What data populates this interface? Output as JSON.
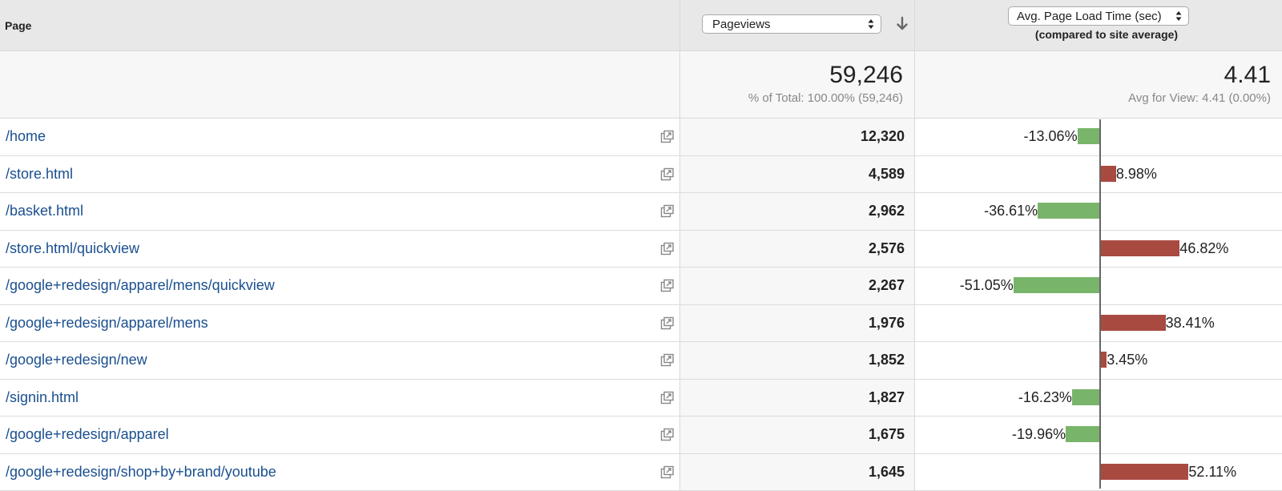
{
  "header": {
    "page_label": "Page",
    "pageviews_select": "Pageviews",
    "loadtime_select": "Avg. Page Load Time (sec)",
    "loadtime_subtitle": "(compared to site average)"
  },
  "totals": {
    "pageviews_value": "59,246",
    "pageviews_sub": "% of Total: 100.00% (59,246)",
    "loadtime_value": "4.41",
    "loadtime_sub": "Avg for View: 4.41 (0.00%)"
  },
  "rows": [
    {
      "page": "/home",
      "pageviews": "12,320",
      "delta_label": "-13.06%",
      "delta": -13.06
    },
    {
      "page": "/store.html",
      "pageviews": "4,589",
      "delta_label": "8.98%",
      "delta": 8.98
    },
    {
      "page": "/basket.html",
      "pageviews": "2,962",
      "delta_label": "-36.61%",
      "delta": -36.61
    },
    {
      "page": "/store.html/quickview",
      "pageviews": "2,576",
      "delta_label": "46.82%",
      "delta": 46.82
    },
    {
      "page": "/google+redesign/apparel/mens/quickview",
      "pageviews": "2,267",
      "delta_label": "-51.05%",
      "delta": -51.05
    },
    {
      "page": "/google+redesign/apparel/mens",
      "pageviews": "1,976",
      "delta_label": "38.41%",
      "delta": 38.41
    },
    {
      "page": "/google+redesign/new",
      "pageviews": "1,852",
      "delta_label": "3.45%",
      "delta": 3.45
    },
    {
      "page": "/signin.html",
      "pageviews": "1,827",
      "delta_label": "-16.23%",
      "delta": -16.23
    },
    {
      "page": "/google+redesign/apparel",
      "pageviews": "1,675",
      "delta_label": "-19.96%",
      "delta": -19.96
    },
    {
      "page": "/google+redesign/shop+by+brand/youtube",
      "pageviews": "1,645",
      "delta_label": "52.11%",
      "delta": 52.11
    }
  ],
  "colors": {
    "link": "#1a4f8f",
    "better": "#78b56a",
    "worse": "#a94a41"
  },
  "icons": {
    "row_action": "open-in-new-window-icon",
    "sort": "sort-down-arrow-icon",
    "select": "select-updown-icon"
  }
}
